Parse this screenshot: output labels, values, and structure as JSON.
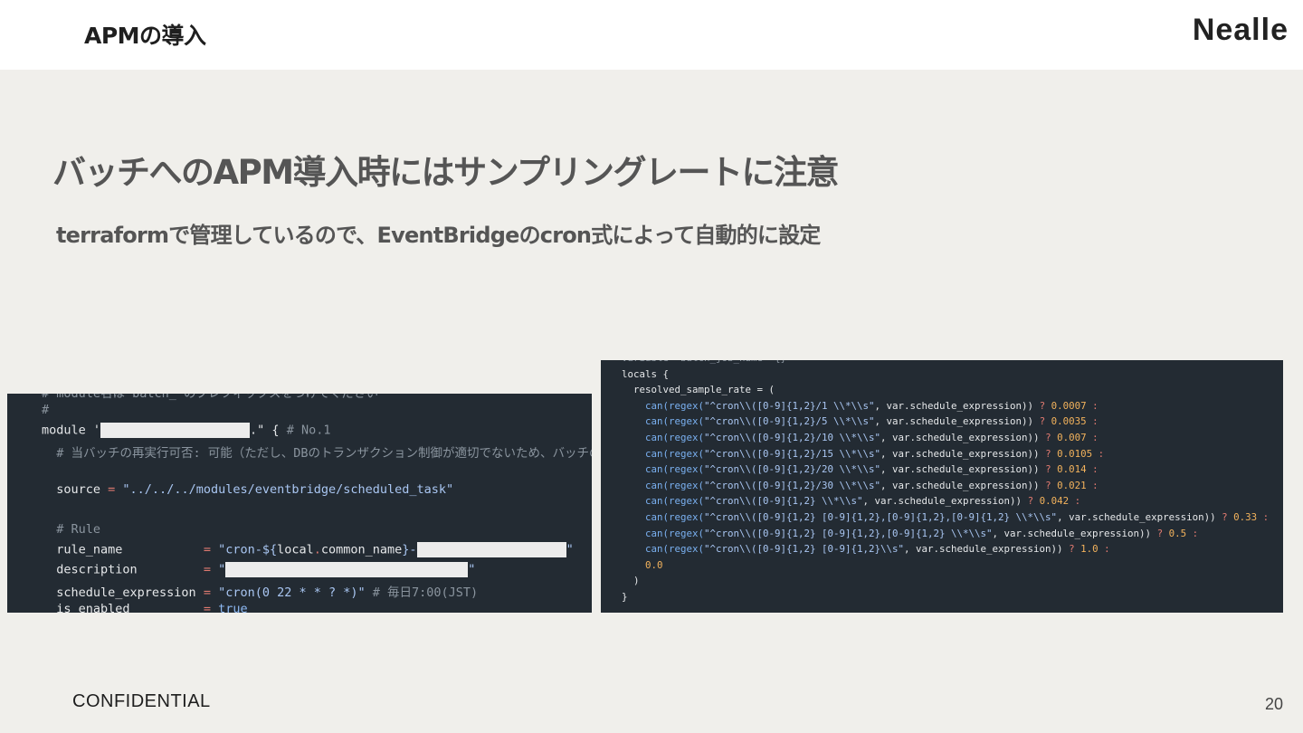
{
  "header": {
    "section_title": "APMの導入",
    "brand": "Nealle"
  },
  "slide": {
    "title": "バッチへのAPM導入時にはサンプリングレートに注意",
    "subtitle": "terraformで管理しているので、EventBridgeのcron式によって自動的に設定"
  },
  "code_left": {
    "lines": [
      {
        "parts": [
          {
            "t": "# module名は batch_ のプレフィックスをつけてください",
            "c": "c-com"
          }
        ]
      },
      {
        "parts": [
          {
            "t": "#",
            "c": "c-com"
          }
        ]
      },
      {
        "parts": [
          {
            "t": "module ",
            "c": "c-white"
          },
          {
            "t": "'",
            "c": "c-white"
          },
          {
            "redact": 1
          },
          {
            "t": ".\" { ",
            "c": "c-white"
          },
          {
            "t": "# No.1",
            "c": "c-com"
          }
        ]
      },
      {
        "parts": [
          {
            "t": "  # 当バッチの再実行可否: 可能（ただし、DBのトランザクション制御が適切でないため、バッチの実",
            "c": "c-com"
          }
        ]
      },
      {
        "parts": [
          {
            "t": "",
            "c": "c-white"
          }
        ]
      },
      {
        "parts": [
          {
            "t": "  source ",
            "c": "c-white"
          },
          {
            "t": "= ",
            "c": "c-op"
          },
          {
            "t": "\"../../../modules/eventbridge/scheduled_task\"",
            "c": "c-str"
          }
        ]
      },
      {
        "parts": [
          {
            "t": "",
            "c": "c-white"
          }
        ]
      },
      {
        "parts": [
          {
            "t": "  # Rule",
            "c": "c-com"
          }
        ]
      },
      {
        "parts": [
          {
            "t": "  rule_name           ",
            "c": "c-white"
          },
          {
            "t": "= ",
            "c": "c-op"
          },
          {
            "t": "\"cron-${",
            "c": "c-str"
          },
          {
            "t": "local",
            "c": "c-white"
          },
          {
            "t": ".",
            "c": "c-op"
          },
          {
            "t": "common_name",
            "c": "c-white"
          },
          {
            "t": "}-",
            "c": "c-str"
          },
          {
            "redact": 2
          },
          {
            "t": "\"",
            "c": "c-str"
          }
        ]
      },
      {
        "parts": [
          {
            "t": "  description         ",
            "c": "c-white"
          },
          {
            "t": "= ",
            "c": "c-op"
          },
          {
            "t": "\"",
            "c": "c-str"
          },
          {
            "redact": 3
          },
          {
            "t": "\"",
            "c": "c-str"
          }
        ]
      },
      {
        "parts": [
          {
            "t": "  schedule_expression ",
            "c": "c-white"
          },
          {
            "t": "= ",
            "c": "c-op"
          },
          {
            "t": "\"cron(0 22 * * ? *)\"",
            "c": "c-str"
          },
          {
            "t": " # 毎日7:00(JST)",
            "c": "c-com"
          }
        ]
      },
      {
        "parts": [
          {
            "t": "  is_enabled          ",
            "c": "c-white"
          },
          {
            "t": "= ",
            "c": "c-op"
          },
          {
            "t": "true",
            "c": "c-kw"
          }
        ]
      }
    ]
  },
  "code_right": {
    "lines": [
      {
        "parts": [
          {
            "t": "variable \"batch_job_name\" {}",
            "c": "c-com"
          }
        ]
      },
      {
        "parts": [
          {
            "t": "locals {",
            "c": "c-white"
          }
        ]
      },
      {
        "parts": [
          {
            "t": "  resolved_sample_rate = (",
            "c": "c-white"
          }
        ]
      },
      {
        "parts": [
          {
            "t": "    can(",
            "c": "c-blue"
          },
          {
            "t": "regex(",
            "c": "c-blue"
          },
          {
            "t": "\"^cron\\\\([0-9]{1,2}/1 \\\\*\\\\s\"",
            "c": "c-str"
          },
          {
            "t": ", var.schedule_expression)) ",
            "c": "c-white"
          },
          {
            "t": "? ",
            "c": "c-op"
          },
          {
            "t": "0.0007",
            "c": "c-num"
          },
          {
            "t": " :",
            "c": "c-op"
          }
        ]
      },
      {
        "parts": [
          {
            "t": "    can(",
            "c": "c-blue"
          },
          {
            "t": "regex(",
            "c": "c-blue"
          },
          {
            "t": "\"^cron\\\\([0-9]{1,2}/5 \\\\*\\\\s\"",
            "c": "c-str"
          },
          {
            "t": ", var.schedule_expression)) ",
            "c": "c-white"
          },
          {
            "t": "? ",
            "c": "c-op"
          },
          {
            "t": "0.0035",
            "c": "c-num"
          },
          {
            "t": " :",
            "c": "c-op"
          }
        ]
      },
      {
        "parts": [
          {
            "t": "    can(",
            "c": "c-blue"
          },
          {
            "t": "regex(",
            "c": "c-blue"
          },
          {
            "t": "\"^cron\\\\([0-9]{1,2}/10 \\\\*\\\\s\"",
            "c": "c-str"
          },
          {
            "t": ", var.schedule_expression)) ",
            "c": "c-white"
          },
          {
            "t": "? ",
            "c": "c-op"
          },
          {
            "t": "0.007",
            "c": "c-num"
          },
          {
            "t": " :",
            "c": "c-op"
          }
        ]
      },
      {
        "parts": [
          {
            "t": "    can(",
            "c": "c-blue"
          },
          {
            "t": "regex(",
            "c": "c-blue"
          },
          {
            "t": "\"^cron\\\\([0-9]{1,2}/15 \\\\*\\\\s\"",
            "c": "c-str"
          },
          {
            "t": ", var.schedule_expression)) ",
            "c": "c-white"
          },
          {
            "t": "? ",
            "c": "c-op"
          },
          {
            "t": "0.0105",
            "c": "c-num"
          },
          {
            "t": " :",
            "c": "c-op"
          }
        ]
      },
      {
        "parts": [
          {
            "t": "    can(",
            "c": "c-blue"
          },
          {
            "t": "regex(",
            "c": "c-blue"
          },
          {
            "t": "\"^cron\\\\([0-9]{1,2}/20 \\\\*\\\\s\"",
            "c": "c-str"
          },
          {
            "t": ", var.schedule_expression)) ",
            "c": "c-white"
          },
          {
            "t": "? ",
            "c": "c-op"
          },
          {
            "t": "0.014",
            "c": "c-num"
          },
          {
            "t": " :",
            "c": "c-op"
          }
        ]
      },
      {
        "parts": [
          {
            "t": "    can(",
            "c": "c-blue"
          },
          {
            "t": "regex(",
            "c": "c-blue"
          },
          {
            "t": "\"^cron\\\\([0-9]{1,2}/30 \\\\*\\\\s\"",
            "c": "c-str"
          },
          {
            "t": ", var.schedule_expression)) ",
            "c": "c-white"
          },
          {
            "t": "? ",
            "c": "c-op"
          },
          {
            "t": "0.021",
            "c": "c-num"
          },
          {
            "t": " :",
            "c": "c-op"
          }
        ]
      },
      {
        "parts": [
          {
            "t": "    can(",
            "c": "c-blue"
          },
          {
            "t": "regex(",
            "c": "c-blue"
          },
          {
            "t": "\"^cron\\\\([0-9]{1,2} \\\\*\\\\s\"",
            "c": "c-str"
          },
          {
            "t": ", var.schedule_expression)) ",
            "c": "c-white"
          },
          {
            "t": "? ",
            "c": "c-op"
          },
          {
            "t": "0.042",
            "c": "c-num"
          },
          {
            "t": " :",
            "c": "c-op"
          }
        ]
      },
      {
        "parts": [
          {
            "t": "    can(",
            "c": "c-blue"
          },
          {
            "t": "regex(",
            "c": "c-blue"
          },
          {
            "t": "\"^cron\\\\([0-9]{1,2} [0-9]{1,2},[0-9]{1,2},[0-9]{1,2} \\\\*\\\\s\"",
            "c": "c-str"
          },
          {
            "t": ", var.schedule_expression)) ",
            "c": "c-white"
          },
          {
            "t": "? ",
            "c": "c-op"
          },
          {
            "t": "0.33",
            "c": "c-num"
          },
          {
            "t": " :",
            "c": "c-op"
          }
        ]
      },
      {
        "parts": [
          {
            "t": "    can(",
            "c": "c-blue"
          },
          {
            "t": "regex(",
            "c": "c-blue"
          },
          {
            "t": "\"^cron\\\\([0-9]{1,2} [0-9]{1,2},[0-9]{1,2} \\\\*\\\\s\"",
            "c": "c-str"
          },
          {
            "t": ", var.schedule_expression)) ",
            "c": "c-white"
          },
          {
            "t": "? ",
            "c": "c-op"
          },
          {
            "t": "0.5",
            "c": "c-num"
          },
          {
            "t": " :",
            "c": "c-op"
          }
        ]
      },
      {
        "parts": [
          {
            "t": "    can(",
            "c": "c-blue"
          },
          {
            "t": "regex(",
            "c": "c-blue"
          },
          {
            "t": "\"^cron\\\\([0-9]{1,2} [0-9]{1,2}\\\\s\"",
            "c": "c-str"
          },
          {
            "t": ", var.schedule_expression)) ",
            "c": "c-white"
          },
          {
            "t": "? ",
            "c": "c-op"
          },
          {
            "t": "1.0",
            "c": "c-num"
          },
          {
            "t": " :",
            "c": "c-op"
          }
        ]
      },
      {
        "parts": [
          {
            "t": "    0.0",
            "c": "c-num"
          }
        ]
      },
      {
        "parts": [
          {
            "t": "  )",
            "c": "c-white"
          }
        ]
      },
      {
        "parts": [
          {
            "t": "}",
            "c": "c-white"
          }
        ]
      }
    ]
  },
  "footer": {
    "confidential": "CONFIDENTIAL",
    "page_number": "20"
  },
  "colors": {
    "background": "#f0efeb",
    "code_background": "#232b33",
    "title_text": "#555555"
  }
}
